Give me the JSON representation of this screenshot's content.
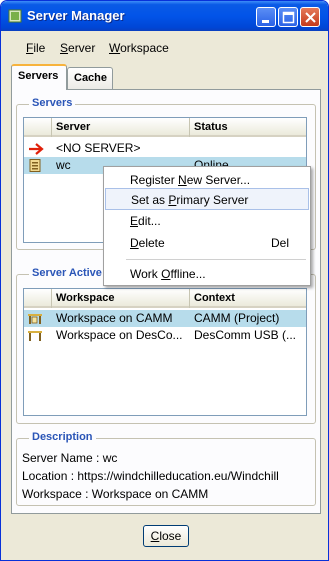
{
  "window": {
    "title": "Server Manager",
    "colors": {
      "titlebar": "#0254e8",
      "group_header": "#2a55b7",
      "selection": "#b7dceb"
    }
  },
  "menu": {
    "file_mnemonic": "F",
    "file_rest": "ile",
    "server_mnemonic": "S",
    "server_rest": "erver",
    "workspace_mnemonic": "W",
    "workspace_rest": "orkspace"
  },
  "tabs": {
    "servers": "Servers",
    "cache": "Cache"
  },
  "servers_group": {
    "title": "Servers",
    "columns": {
      "server": "Server",
      "status": "Status"
    },
    "rows": [
      {
        "server": "<NO SERVER>",
        "status": "",
        "icon": "red-arrow-icon"
      },
      {
        "server": "wc",
        "status": "Online",
        "icon": "server-icon"
      }
    ]
  },
  "context_menu": {
    "register": {
      "before": "Register ",
      "mnemonic": "N",
      "after": "ew Server..."
    },
    "set_primary": {
      "before": "Set as ",
      "mnemonic": "P",
      "after": "rimary Server"
    },
    "edit": {
      "before": "",
      "mnemonic": "E",
      "after": "dit..."
    },
    "delete": {
      "before": "",
      "mnemonic": "D",
      "after": "elete",
      "shortcut": "Del"
    },
    "offline": {
      "before": "Work ",
      "mnemonic": "O",
      "after": "ffline..."
    }
  },
  "active_group": {
    "title": "Server Active Workspace",
    "columns": {
      "workspace": "Workspace",
      "context": "Context"
    },
    "rows": [
      {
        "workspace": "Workspace on CAMM",
        "context": "CAMM (Project)",
        "icon": "workspace-icon"
      },
      {
        "workspace": "Workspace on DesCo...",
        "context": "DesComm USB (...",
        "icon": "workspace-icon"
      }
    ]
  },
  "description": {
    "title": "Description",
    "server_name": "Server Name : wc",
    "location": "Location : https://windchilleducation.eu/Windchill",
    "workspace": "Workspace : Workspace on CAMM"
  },
  "buttons": {
    "close_mnemonic": "C",
    "close_rest": "lose"
  }
}
